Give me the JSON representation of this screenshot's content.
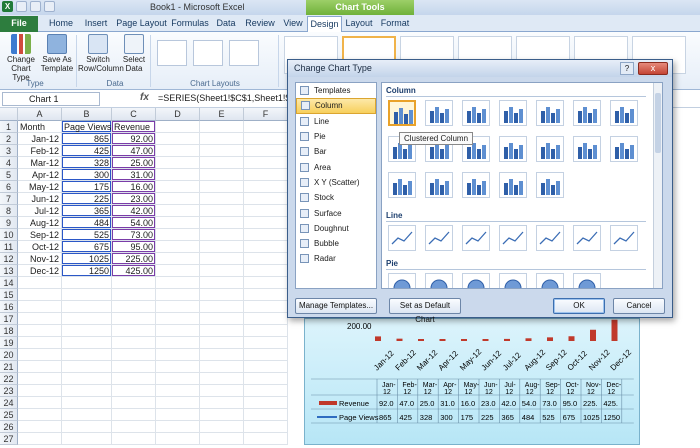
{
  "window": {
    "title": "Book1 - Microsoft Excel",
    "context_tab": "Chart Tools"
  },
  "tabs": [
    "File",
    "Home",
    "Insert",
    "Page Layout",
    "Formulas",
    "Data",
    "Review",
    "View",
    "Design",
    "Layout",
    "Format"
  ],
  "active_tab": "Design",
  "ribbon": {
    "buttons": [
      {
        "label1": "Change",
        "label2": "Chart Type",
        "icon": "change-chart-type-icon"
      },
      {
        "label1": "Save As",
        "label2": "Template",
        "icon": "save-template-icon"
      },
      {
        "label1": "Switch",
        "label2": "Row/Column",
        "icon": "switch-row-column-icon"
      },
      {
        "label1": "Select",
        "label2": "Data",
        "icon": "select-data-icon"
      }
    ],
    "groups": {
      "type": "Type",
      "data": "Data",
      "layouts": "Chart Layouts"
    }
  },
  "formula_bar": {
    "name_box": "Chart 1",
    "fx": "fx",
    "formula": "=SERIES(Sheet1!$C$1,Sheet1!$A"
  },
  "sheet": {
    "columns": [
      "A",
      "B",
      "C",
      "D",
      "E",
      "F"
    ],
    "headers": [
      "Month",
      "Page Views",
      "Revenue"
    ],
    "rows": [
      [
        "Jan-12",
        "865",
        "92.00"
      ],
      [
        "Feb-12",
        "425",
        "47.00"
      ],
      [
        "Mar-12",
        "328",
        "25.00"
      ],
      [
        "Apr-12",
        "300",
        "31.00"
      ],
      [
        "May-12",
        "175",
        "16.00"
      ],
      [
        "Jun-12",
        "225",
        "23.00"
      ],
      [
        "Jul-12",
        "365",
        "42.00"
      ],
      [
        "Aug-12",
        "484",
        "54.00"
      ],
      [
        "Sep-12",
        "525",
        "73.00"
      ],
      [
        "Oct-12",
        "675",
        "95.00"
      ],
      [
        "Nov-12",
        "1025",
        "225.00"
      ],
      [
        "Dec-12",
        "1250",
        "425.00"
      ]
    ],
    "row_numbers": [
      "1",
      "2",
      "3",
      "4",
      "5",
      "6",
      "7",
      "8",
      "9",
      "10",
      "11",
      "12",
      "13",
      "14",
      "15",
      "16",
      "17",
      "18",
      "19",
      "20",
      "21",
      "22",
      "23",
      "24",
      "25",
      "26",
      "27"
    ]
  },
  "background_chart": {
    "visible_tick": "200.00",
    "months": [
      "Jan-12",
      "Feb-12",
      "Mar-12",
      "Apr-12",
      "May-12",
      "Jun-12",
      "Jul-12",
      "Aug-12",
      "Sep-12",
      "Oct-12",
      "Nov-12",
      "Dec-12"
    ],
    "table_months": [
      "Jan-12",
      "Feb-12",
      "Mar-12",
      "Apr-12",
      "May-12",
      "Jun-12",
      "Jul-12",
      "Aug-12",
      "Sep-12",
      "Oct-12",
      "Nov-12",
      "Dec-12"
    ],
    "revenue_label": "Revenue",
    "revenue_values": [
      "92.0",
      "47.0",
      "25.0",
      "31.0",
      "16.0",
      "23.0",
      "42.0",
      "54.0",
      "73.0",
      "95.0",
      "225.",
      "425."
    ],
    "views_label": "Page Views",
    "views_values": [
      "865",
      "425",
      "328",
      "300",
      "175",
      "225",
      "365",
      "484",
      "525",
      "675",
      "1025",
      "1250"
    ],
    "revenue_color": "#c0392b",
    "views_color": "#2e6cc0"
  },
  "dialog": {
    "title": "Change Chart Type",
    "help": "?",
    "close": "x",
    "types": [
      "Templates",
      "Column",
      "Line",
      "Pie",
      "Bar",
      "Area",
      "X Y (Scatter)",
      "Stock",
      "Surface",
      "Doughnut",
      "Bubble",
      "Radar"
    ],
    "selected_type": "Column",
    "sections": {
      "column": "Column",
      "line": "Line",
      "pie": "Pie"
    },
    "tooltip": "Clustered Column",
    "buttons": {
      "manage": "Manage Templates...",
      "default": "Set as Default Chart",
      "ok": "OK",
      "cancel": "Cancel"
    }
  }
}
